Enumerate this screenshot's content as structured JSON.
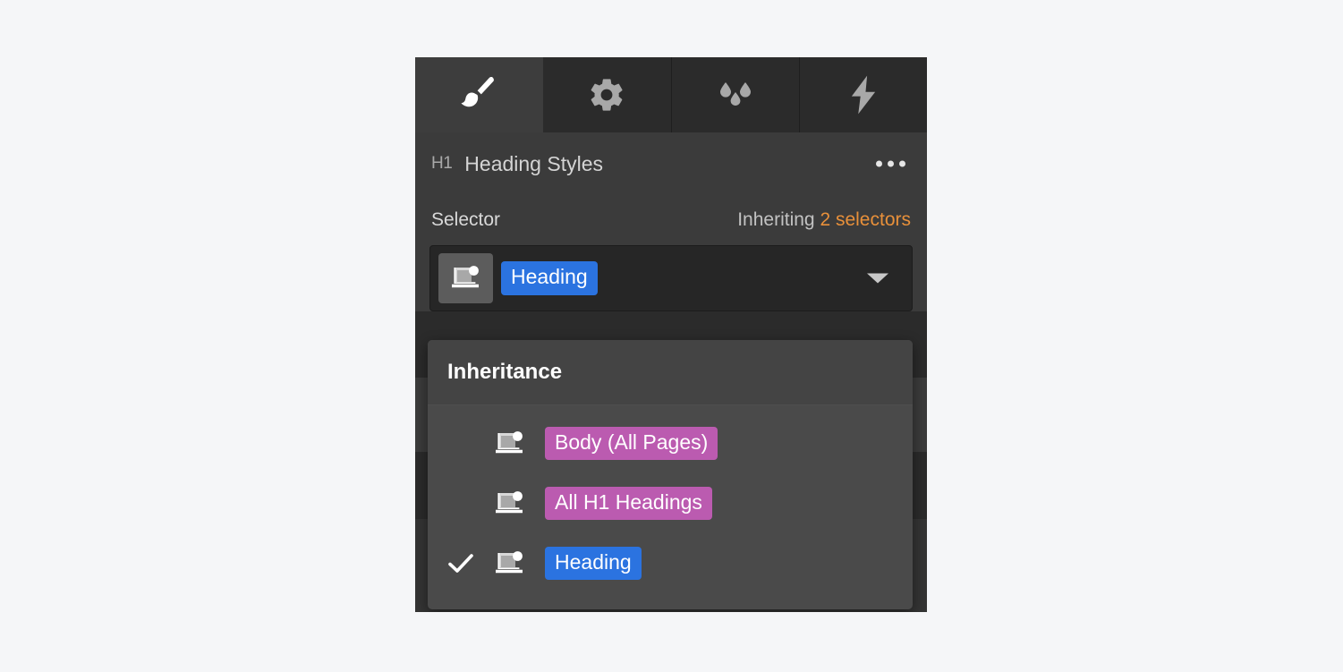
{
  "panel": {
    "tabs": [
      {
        "name": "style-tab",
        "icon": "paintbrush-icon",
        "active": true
      },
      {
        "name": "settings-tab",
        "icon": "gear-icon",
        "active": false
      },
      {
        "name": "effects-tab",
        "icon": "water-drops-icon",
        "active": false
      },
      {
        "name": "interactions-tab",
        "icon": "lightning-bolt-icon",
        "active": false
      }
    ],
    "header": {
      "tag_badge": "H1",
      "title": "Heading Styles",
      "more_menu_icon": "ellipsis-icon"
    },
    "selector_row": {
      "label": "Selector",
      "inheriting_label": "Inheriting",
      "inheriting_count": "2 selectors"
    },
    "selector_field": {
      "device_icon": "desktop-breakpoint-icon",
      "selected_class": "Heading",
      "caret_icon": "chevron-down-icon"
    }
  },
  "dropdown": {
    "title": "Inheritance",
    "items": [
      {
        "label": "Body (All Pages)",
        "color": "purple",
        "checked": false,
        "icon": "desktop-breakpoint-icon"
      },
      {
        "label": "All H1 Headings",
        "color": "purple",
        "checked": false,
        "icon": "desktop-breakpoint-icon"
      },
      {
        "label": "Heading",
        "color": "blue",
        "checked": true,
        "icon": "desktop-breakpoint-icon"
      }
    ],
    "check_icon": "checkmark-icon"
  },
  "colors": {
    "accent_blue": "#2b73e0",
    "accent_purple": "#bb5bb0",
    "accent_orange": "#e8903a",
    "panel_bg": "#3b3b3b",
    "dropdown_bg": "#4a4a4a",
    "tabbar_bg": "#2b2b2b",
    "page_bg": "#f5f6f8"
  },
  "background_rows": [
    {
      "name": "bg-row-1",
      "height": 74,
      "bg": "#2b2b2b"
    },
    {
      "name": "bg-row-2",
      "height": 83,
      "bg": "#3b3b3b"
    },
    {
      "name": "bg-row-3",
      "height": 75,
      "bg": "#2b2b2b"
    },
    {
      "name": "bg-row-4",
      "height": 104,
      "bg": "#343434"
    }
  ]
}
